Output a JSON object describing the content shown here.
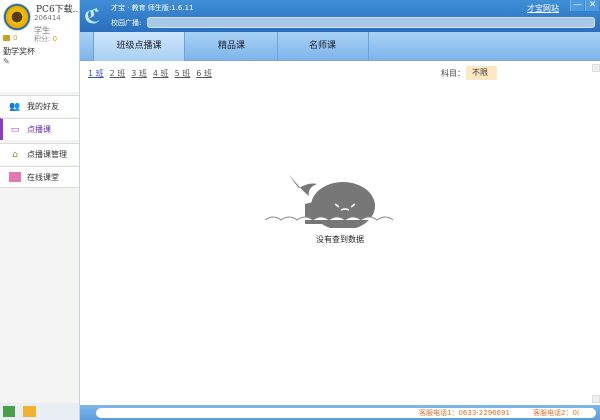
{
  "profile": {
    "name": "PC6下载..",
    "id": "206414",
    "role": "学生",
    "coins": "0",
    "points_label": "积分:",
    "points": "0",
    "signature": "勤学奖杯"
  },
  "sidebar": {
    "items": [
      {
        "label": "我的好友",
        "icon": "friends-icon"
      },
      {
        "label": "点播课",
        "icon": "video-icon"
      },
      {
        "label": "点播课管理",
        "icon": "bank-icon"
      },
      {
        "label": "在线课堂",
        "icon": "classroom-icon"
      }
    ]
  },
  "header": {
    "title": "才宝 · 教育 师生版:1.6.11",
    "broadcast_label": "校园广播:",
    "site_link": "才宝网站",
    "minimize": "—",
    "close": "✕"
  },
  "tabs": [
    "班级点播课",
    "精品课",
    "名师课"
  ],
  "classes": [
    "1 班",
    "2 班",
    "3 班",
    "4 班",
    "5 班",
    "6 班"
  ],
  "filter": {
    "label": "科目：",
    "value": "不限"
  },
  "empty_message": "没有查到数据",
  "footer": {
    "phone1": "客服电话1：0633-2296691",
    "phone2": "客服电话2：0("
  },
  "colors": {
    "header": "#2a6fbe",
    "accent": "#8a3fc8",
    "phone": "#e0702a"
  }
}
